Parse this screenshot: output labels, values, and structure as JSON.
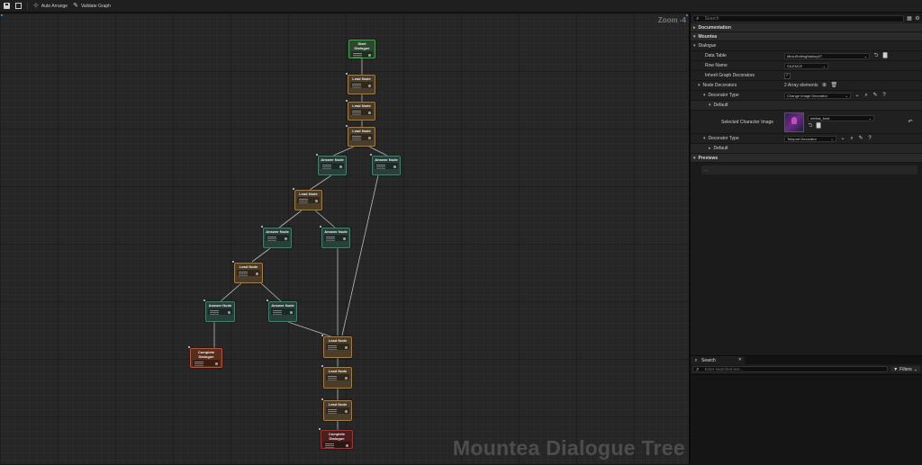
{
  "toolbar": {
    "items": [
      {
        "name": "save-button",
        "icon": "save-icon",
        "label": ""
      },
      {
        "name": "browse-button",
        "icon": "browse-icon",
        "label": ""
      },
      {
        "name": "auto-arrange-button",
        "icon": "arrange-icon",
        "label": "Auto Arrange"
      },
      {
        "name": "validate-graph-button",
        "icon": "validate-icon",
        "label": "Validate Graph"
      }
    ]
  },
  "graph": {
    "zoom_label": "Zoom -4",
    "watermark": "Mountea Dialogue Tree",
    "nodes": [
      {
        "id": "n1",
        "kind": "start",
        "title": "Start Dialogue"
      },
      {
        "id": "n2",
        "kind": "lead",
        "title": "Lead Node"
      },
      {
        "id": "n3",
        "kind": "lead",
        "title": "Lead Node"
      },
      {
        "id": "n4",
        "kind": "lead",
        "title": "Lead Node"
      },
      {
        "id": "n5",
        "kind": "answer",
        "title": "Answer Node"
      },
      {
        "id": "n6",
        "kind": "answer",
        "title": "Answer Node"
      },
      {
        "id": "n7",
        "kind": "lead",
        "title": "Lead Node"
      },
      {
        "id": "n8",
        "kind": "answer",
        "title": "Answer Node"
      },
      {
        "id": "n9",
        "kind": "answer",
        "title": "Answer Node"
      },
      {
        "id": "n10",
        "kind": "lead",
        "title": "Lead Node"
      },
      {
        "id": "n11",
        "kind": "answer",
        "title": "Answer Node"
      },
      {
        "id": "n12",
        "kind": "answer",
        "title": "Answer Node"
      },
      {
        "id": "n13",
        "kind": "complete",
        "title": "Complete Dialogue"
      },
      {
        "id": "n14",
        "kind": "lead",
        "title": "Lead Node"
      },
      {
        "id": "n15",
        "kind": "lead",
        "title": "Lead Node"
      },
      {
        "id": "n16",
        "kind": "lead",
        "title": "Lead Node"
      },
      {
        "id": "n17",
        "kind": "complete-dark",
        "title": "Complete Dialogue"
      }
    ]
  },
  "details": {
    "search_placeholder": "Search",
    "categories": {
      "documentation": "Documentation",
      "mountea": "Mountea",
      "dialogue": "Dialogue",
      "default": "Default",
      "default2": "Default",
      "previews": "Previews"
    },
    "rows": {
      "data_table_label": "Data Table",
      "data_table_value": "MiniuRettingNakiep07",
      "row_name_label": "Row Name",
      "row_name_value": "SILENCE",
      "inherit_label": "Inherit Graph Decorators",
      "inherit_checked": true,
      "node_decorators_label": "Node Decorators",
      "node_decorators_value": "2 Array elements",
      "decorator_type_label": "Decorator Type",
      "decorator_type_value": "Change Image Decorator",
      "selected_image_label": "Selected Character Image",
      "selected_image_value": "mirlias_bust",
      "decorator_type2_label": "Decorator Type",
      "decorator_type2_value": "Teleport Decorator"
    },
    "preview_text": "..."
  },
  "search_panel": {
    "tab_label": "Search",
    "input_placeholder": "Enter searched text...",
    "filters_label": "Filters"
  },
  "colors": {
    "lead": "#b57a22",
    "answer": "#2f8a70",
    "start": "#2fb33a",
    "complete": "#e0451e"
  }
}
